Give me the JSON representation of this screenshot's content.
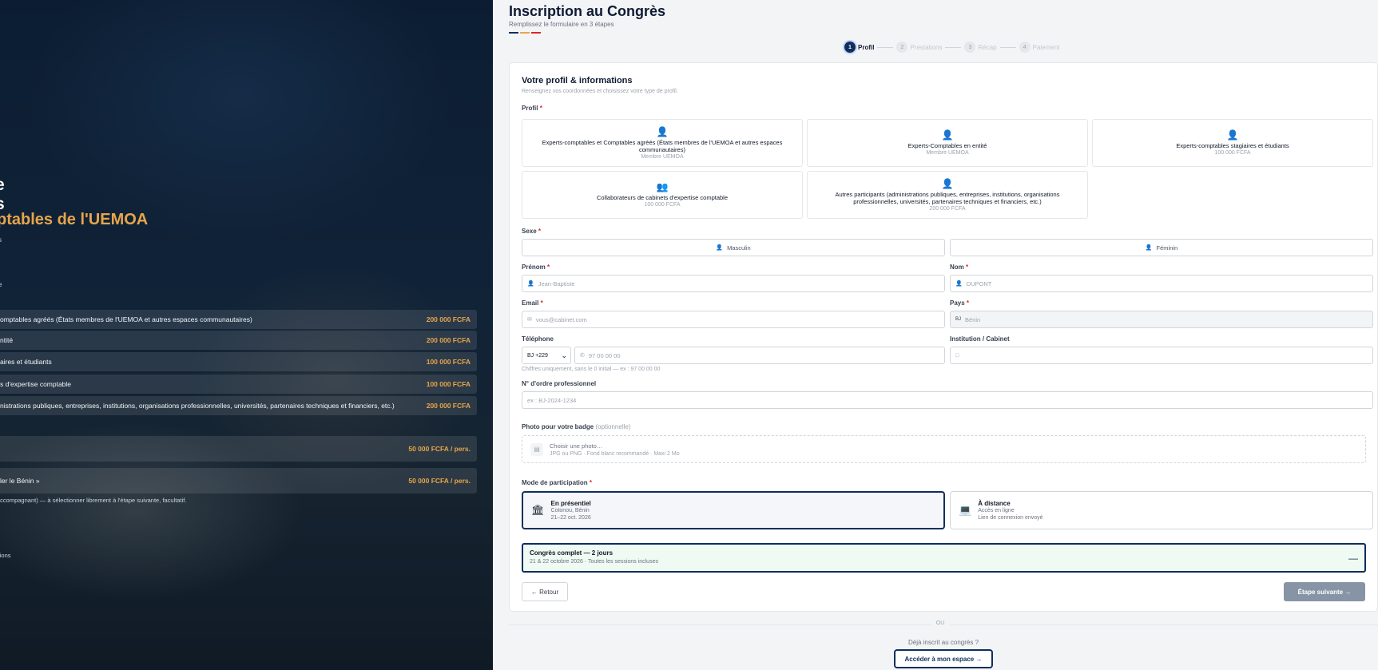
{
  "hero": {
    "title_line1": "e",
    "title_line2": "s",
    "title_line3": "ptables de l'UEMOA",
    "tiny1": "s",
    "tiny2": "e",
    "prices": [
      {
        "label": "omptables agréés (États membres de l'UEMOA et autres espaces communautaires)",
        "value": "200 000 FCFA"
      },
      {
        "label": "ntité",
        "value": "200 000 FCFA"
      },
      {
        "label": "aires et étudiants",
        "value": "100 000 FCFA"
      },
      {
        "label": "s d'expertise comptable",
        "value": "100 000 FCFA"
      },
      {
        "label": "nistrations publiques, entreprises, institutions, organisations professionnelles, universités, partenaires techniques et financiers, etc.)",
        "value": "200 000 FCFA"
      }
    ],
    "extras": [
      {
        "label": "",
        "value": "50 000 FCFA / pers."
      },
      {
        "label": "ler le Bénin »",
        "value": "50 000 FCFA / pers."
      }
    ],
    "note": "accompagnant) — à sélectionner librement à l'étape suivante, facultatif.",
    "sessions": "sions"
  },
  "header": {
    "title": "Inscription au Congrès",
    "subtitle": "Remplissez le formulaire en 3 étapes",
    "flag_colors": [
      "#0f2f5c",
      "#e7a54a",
      "#dc2626"
    ]
  },
  "stepper": [
    {
      "num": "1",
      "label": "Profil"
    },
    {
      "num": "2",
      "label": "Prestations"
    },
    {
      "num": "3",
      "label": "Récap"
    },
    {
      "num": "4",
      "label": "Paiement"
    }
  ],
  "form": {
    "title": "Votre profil & informations",
    "subtitle": "Renseignez vos coordonnées et choisissez votre type de profil.",
    "profil_label": "Profil",
    "required_mark": "*",
    "profiles": [
      {
        "title": "Experts-comptables et Comptables agréés (États membres de l'UEMOA et autres espaces communautaires)",
        "price": "Membre UEMOA"
      },
      {
        "title": "Experts-Comptables en entité",
        "price": "Membre UEMOA"
      },
      {
        "title": "Experts-comptables stagiaires et étudiants",
        "price": "100 000 FCFA"
      },
      {
        "title": "Collaborateurs de cabinets d'expertise comptable",
        "price": "100 000 FCFA"
      },
      {
        "title": "Autres participants (administrations publiques, entreprises, institutions, organisations professionnelles, universités, partenaires techniques et financiers, etc.)",
        "price": "200 000 FCFA"
      }
    ],
    "sexe_label": "Sexe",
    "sexe_options": [
      "Masculin",
      "Féminin"
    ],
    "prenom_label": "Prénom",
    "prenom_placeholder": "Jean-Baptiste",
    "nom_label": "Nom",
    "nom_placeholder": "DUPONT",
    "email_label": "Email",
    "email_placeholder": "vous@cabinet.com",
    "pays_label": "Pays",
    "pays_code": "BJ",
    "pays_value": "Bénin",
    "tel_label": "Téléphone",
    "tel_code": "BJ +229",
    "tel_placeholder": "97 00 00 00",
    "tel_hint": "Chiffres uniquement, sans le 0 initial — ex : 97 00 00 00",
    "institution_label": "Institution / Cabinet",
    "ordre_label": "N° d'ordre professionnel",
    "ordre_placeholder": "ex : BJ-2024-1234",
    "photo_label": "Photo pour votre badge",
    "photo_optional": "(optionnelle)",
    "photo_choose": "Choisir une photo…",
    "photo_hint": "JPG ou PNG · Fond blanc recommandé · Maxi 2 Mo",
    "mode_label": "Mode de participation",
    "modes": [
      {
        "title": "En présentiel",
        "line1": "Cotonou, Bénin",
        "line2": "21–22 oct. 2026"
      },
      {
        "title": "À distance",
        "line1": "Accès en ligne",
        "line2": "Lien de connexion envoyé"
      }
    ],
    "congres_title": "Congrès complet — 2 jours",
    "congres_sub": "21 & 22 octobre 2026 · Toutes les sessions incluses",
    "back_label": "← Retour",
    "next_label": "Étape suivante →"
  },
  "footer": {
    "or": "OU",
    "already": "Déjà inscrit au congrès ?",
    "space_label": "Accéder à mon espace →"
  }
}
